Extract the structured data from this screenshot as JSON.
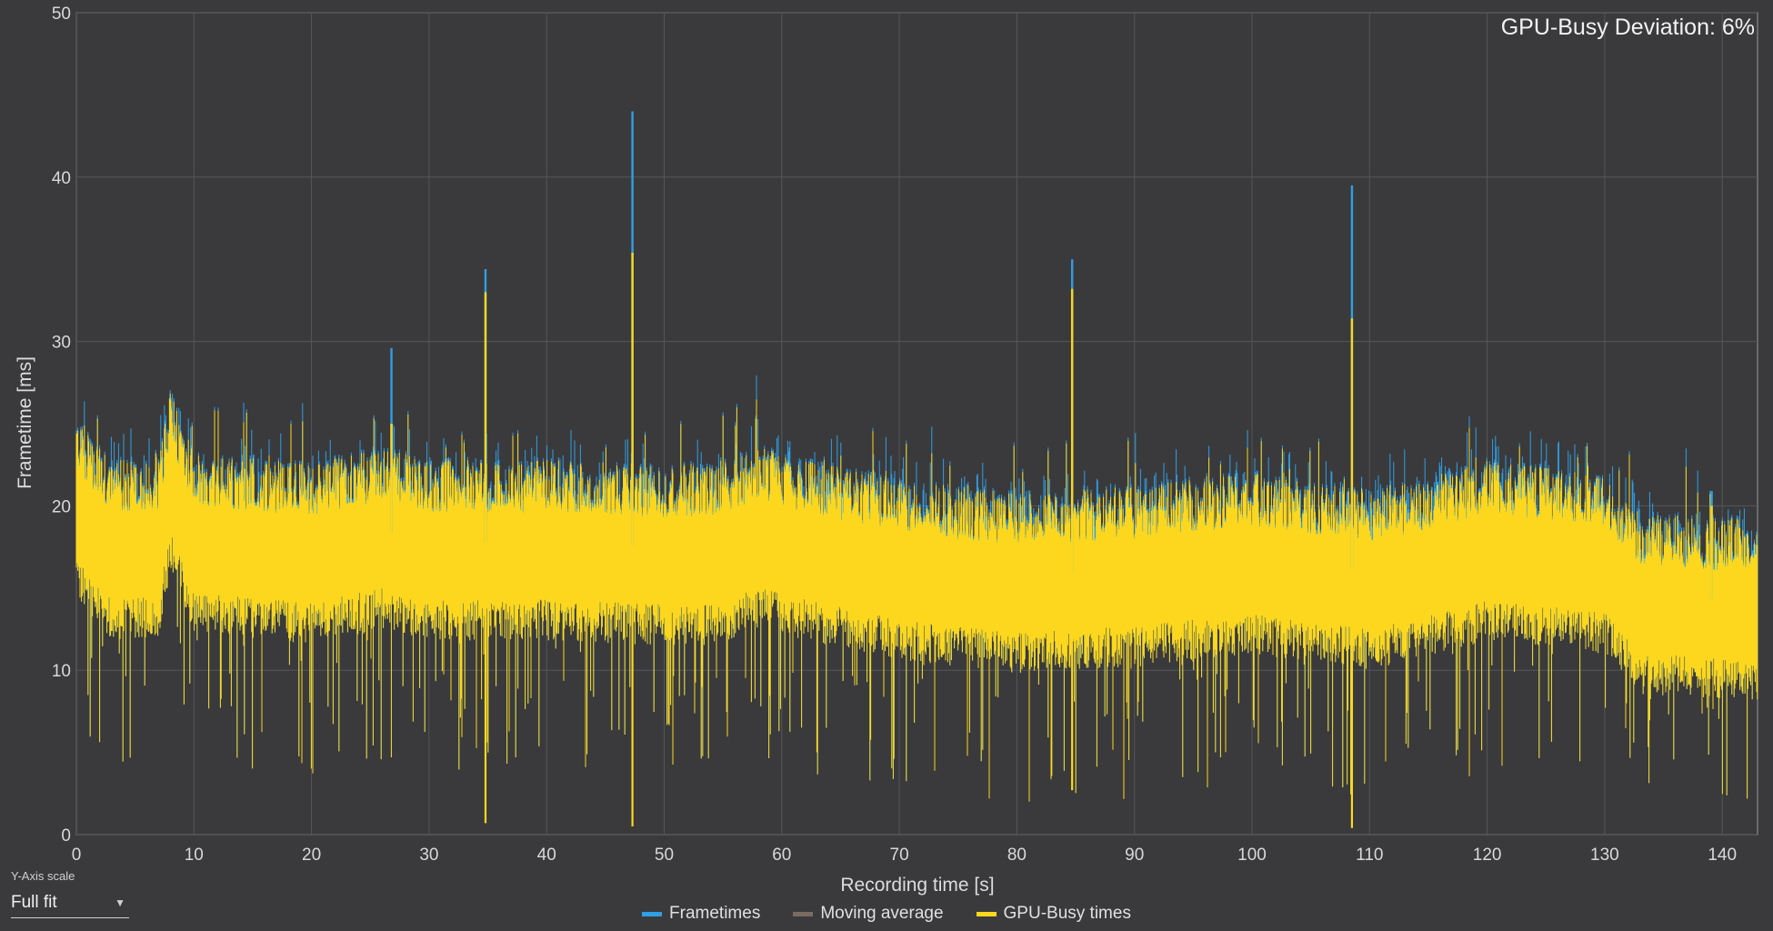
{
  "annotation": "GPU-Busy Deviation: 6%",
  "y_axis_scale": {
    "label": "Y-Axis scale",
    "value": "Full fit"
  },
  "chart_data": {
    "type": "bar",
    "xlabel": "Recording time [s]",
    "ylabel": "Frametime [ms]",
    "xlim": [
      0,
      143
    ],
    "ylim": [
      0,
      50
    ],
    "xticks": [
      0,
      10,
      20,
      30,
      40,
      50,
      60,
      70,
      80,
      90,
      100,
      110,
      120,
      130,
      140
    ],
    "yticks": [
      0,
      10,
      20,
      30,
      40,
      50
    ],
    "grid": true,
    "legend_position": "bottom-center",
    "series": [
      {
        "name": "Frametimes",
        "color": "#2f9fe6"
      },
      {
        "name": "Moving average",
        "color": "#7b6b62"
      },
      {
        "name": "GPU-Busy times",
        "color": "#fcd71e"
      }
    ],
    "baseline_profile": [
      [
        0,
        20.5
      ],
      [
        3,
        17.8
      ],
      [
        7,
        18.0
      ],
      [
        8,
        22.0
      ],
      [
        10,
        18.2
      ],
      [
        20,
        17.6
      ],
      [
        26,
        18.5
      ],
      [
        30,
        17.8
      ],
      [
        40,
        17.8
      ],
      [
        50,
        17.5
      ],
      [
        55,
        17.6
      ],
      [
        58,
        18.6
      ],
      [
        62,
        17.8
      ],
      [
        70,
        16.6
      ],
      [
        80,
        15.8
      ],
      [
        90,
        16.2
      ],
      [
        100,
        17.0
      ],
      [
        110,
        16.0
      ],
      [
        115,
        16.8
      ],
      [
        120,
        17.8
      ],
      [
        130,
        17.0
      ],
      [
        133,
        14.5
      ],
      [
        143,
        14.2
      ]
    ],
    "spikes": [
      {
        "x": 26.8,
        "frametime": 29.6,
        "gpu_busy": 25.0
      },
      {
        "x": 34.8,
        "frametime": 34.4,
        "gpu_busy": 33.0
      },
      {
        "x": 47.3,
        "frametime": 44.0,
        "gpu_busy": 35.4
      },
      {
        "x": 84.7,
        "frametime": 35.0,
        "gpu_busy": 33.2
      },
      {
        "x": 108.5,
        "frametime": 39.5,
        "gpu_busy": 31.4
      },
      {
        "x": 139.1,
        "frametime": 20.9,
        "gpu_busy": 20.0
      }
    ],
    "dips": [
      {
        "x": 34.8,
        "gpu_busy": 0.7
      },
      {
        "x": 47.3,
        "gpu_busy": 0.5
      },
      {
        "x": 108.5,
        "gpu_busy": 0.4
      },
      {
        "x": 84.7,
        "gpu_busy": 2.7
      }
    ]
  }
}
